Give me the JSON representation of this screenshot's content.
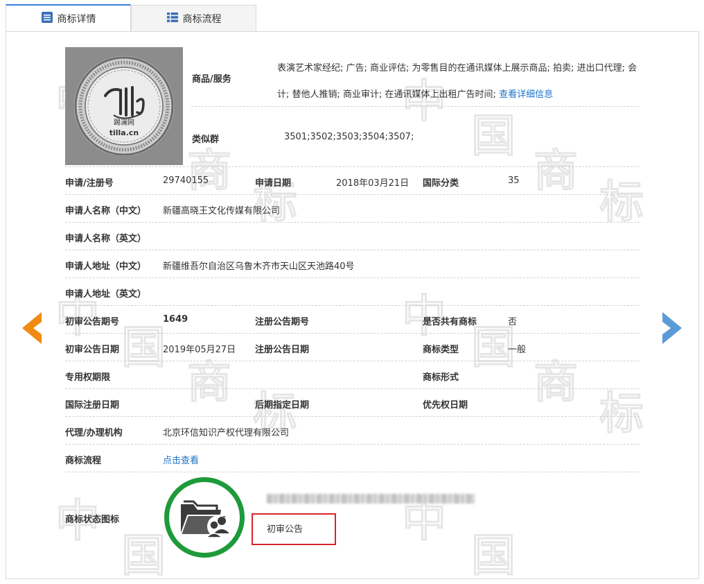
{
  "tabs": [
    {
      "label": "商标详情",
      "icon": "list-icon",
      "active": true
    },
    {
      "label": "商标流程",
      "icon": "grid-icon",
      "active": false
    }
  ],
  "watermark_chars": [
    "中",
    "国",
    "商",
    "标"
  ],
  "logo": {
    "text": "tilla.cn",
    "cn_text": "踢澜网"
  },
  "goods": {
    "label": "商品/服务",
    "text": "表演艺术家经纪; 广告; 商业评估; 为零售目的在通讯媒体上展示商品; 拍卖; 进出口代理; 会计; 替他人推销; 商业审计; 在通讯媒体上出租广告时间; ",
    "link": "查看详细信息"
  },
  "similar_group": {
    "label": "类似群",
    "value": "3501;3502;3503;3504;3507;"
  },
  "fields": {
    "reg_no": {
      "label": "申请/注册号",
      "value": "29740155"
    },
    "apply_date": {
      "label": "申请日期",
      "value": "2018年03月21日"
    },
    "intl_class": {
      "label": "国际分类",
      "value": "35"
    },
    "applicant_cn": {
      "label": "申请人名称（中文）",
      "value": "新疆高晓王文化传媒有限公司"
    },
    "applicant_en": {
      "label": "申请人名称（英文）",
      "value": ""
    },
    "address_cn": {
      "label": "申请人地址（中文）",
      "value": "新疆维吾尔自治区乌鲁木齐市天山区天池路40号"
    },
    "address_en": {
      "label": "申请人地址（英文）",
      "value": ""
    },
    "prelim_issue": {
      "label": "初审公告期号",
      "value": "1649"
    },
    "reg_issue": {
      "label": "注册公告期号",
      "value": ""
    },
    "shared": {
      "label": "是否共有商标",
      "value": "否"
    },
    "prelim_date": {
      "label": "初审公告日期",
      "value": "2019年05月27日"
    },
    "reg_date": {
      "label": "注册公告日期",
      "value": ""
    },
    "mark_type": {
      "label": "商标类型",
      "value": "一般"
    },
    "exclusive_period": {
      "label": "专用权期限",
      "value": ""
    },
    "mark_form": {
      "label": "商标形式",
      "value": ""
    },
    "intl_reg_date": {
      "label": "国际注册日期",
      "value": ""
    },
    "later_date": {
      "label": "后期指定日期",
      "value": ""
    },
    "priority_date": {
      "label": "优先权日期",
      "value": ""
    },
    "agent": {
      "label": "代理/办理机构",
      "value": "北京环信知识产权代理有限公司"
    },
    "process": {
      "label": "商标流程",
      "link": "点击查看"
    },
    "status_icon": {
      "label": "商标状态图标",
      "status": "初审公告"
    }
  },
  "colors": {
    "link": "#1a73c8",
    "arrow_left": "#f08a12",
    "arrow_right": "#5b9bd5",
    "status_ring": "#1e9a3a",
    "status_box": "#d8232a",
    "tab_border": "#3a7ed8"
  }
}
